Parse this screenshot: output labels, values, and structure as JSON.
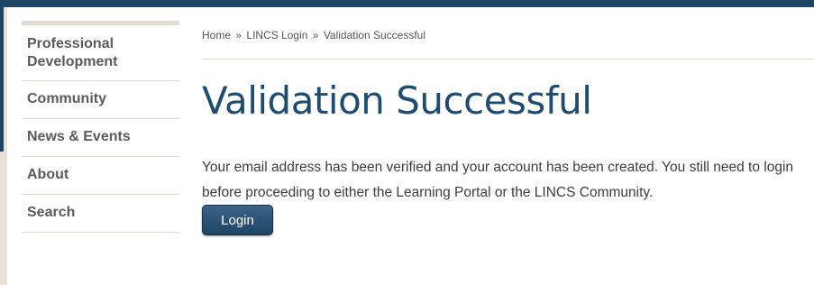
{
  "sidebar": {
    "items": [
      {
        "label": "Professional Development"
      },
      {
        "label": "Community"
      },
      {
        "label": "News & Events"
      },
      {
        "label": "About"
      },
      {
        "label": "Search"
      }
    ]
  },
  "breadcrumb": {
    "home": "Home",
    "login": "LINCS Login",
    "current": "Validation Successful",
    "separator": "»"
  },
  "main": {
    "title": "Validation Successful",
    "message": "Your email address has been verified and your account has been created. You still need to login before proceeding to either the Learning Portal or the LINCS Community.",
    "login_button": "Login"
  },
  "colors": {
    "top_bar": "#1d4664",
    "title": "#1f4c6f",
    "button": "#2a5173"
  }
}
